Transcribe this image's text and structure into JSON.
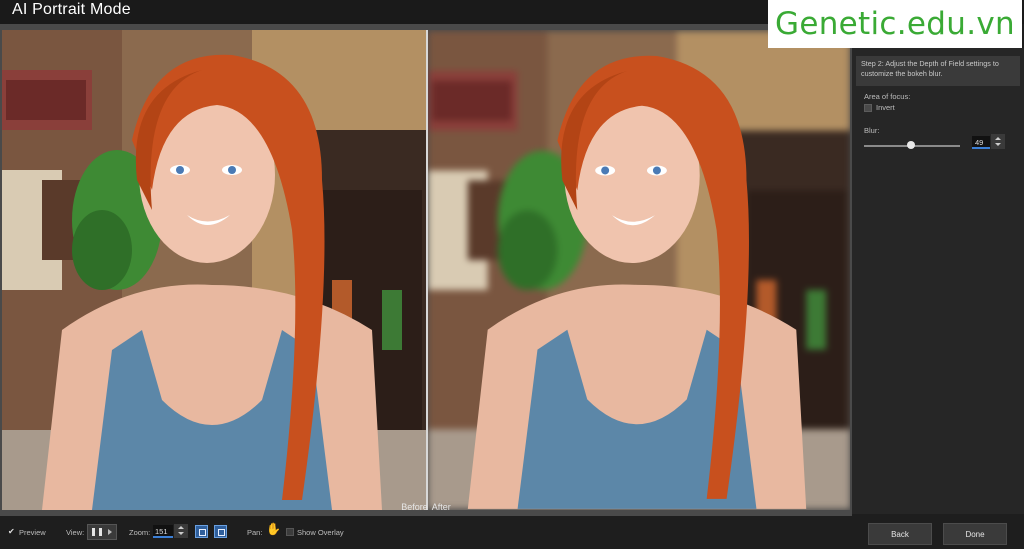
{
  "window": {
    "title": "AI Portrait Mode"
  },
  "watermark": {
    "text": "Genetic.edu.vn"
  },
  "preview": {
    "before_label": "Before",
    "after_label": "After"
  },
  "panel": {
    "step_text": "Step 2: Adjust the Depth of Field settings to customize the bokeh blur.",
    "area_of_focus_label": "Area of focus:",
    "invert_label": "Invert",
    "invert_checked": false,
    "blur_label": "Blur:",
    "blur_value": "49",
    "blur_level": 0.49
  },
  "toolbar": {
    "preview_label": "Preview",
    "preview_checked": true,
    "view_label": "View:",
    "zoom_label": "Zoom:",
    "zoom_value": "151",
    "pan_label": "Pan:",
    "show_overlay_label": "Show Overlay",
    "show_overlay_checked": false,
    "back_label": "Back",
    "done_label": "Done"
  },
  "icons": {
    "preview_check": "check-icon",
    "view_mode": "split-view-icon",
    "zoom_fit": "zoom-fit-icon",
    "zoom_actual": "zoom-actual-size-icon",
    "pan": "hand-icon"
  },
  "colors": {
    "accent": "#3b7fd6",
    "watermark": "#3aaa35",
    "hair": "#c8501e",
    "top": "#5c87a8"
  }
}
